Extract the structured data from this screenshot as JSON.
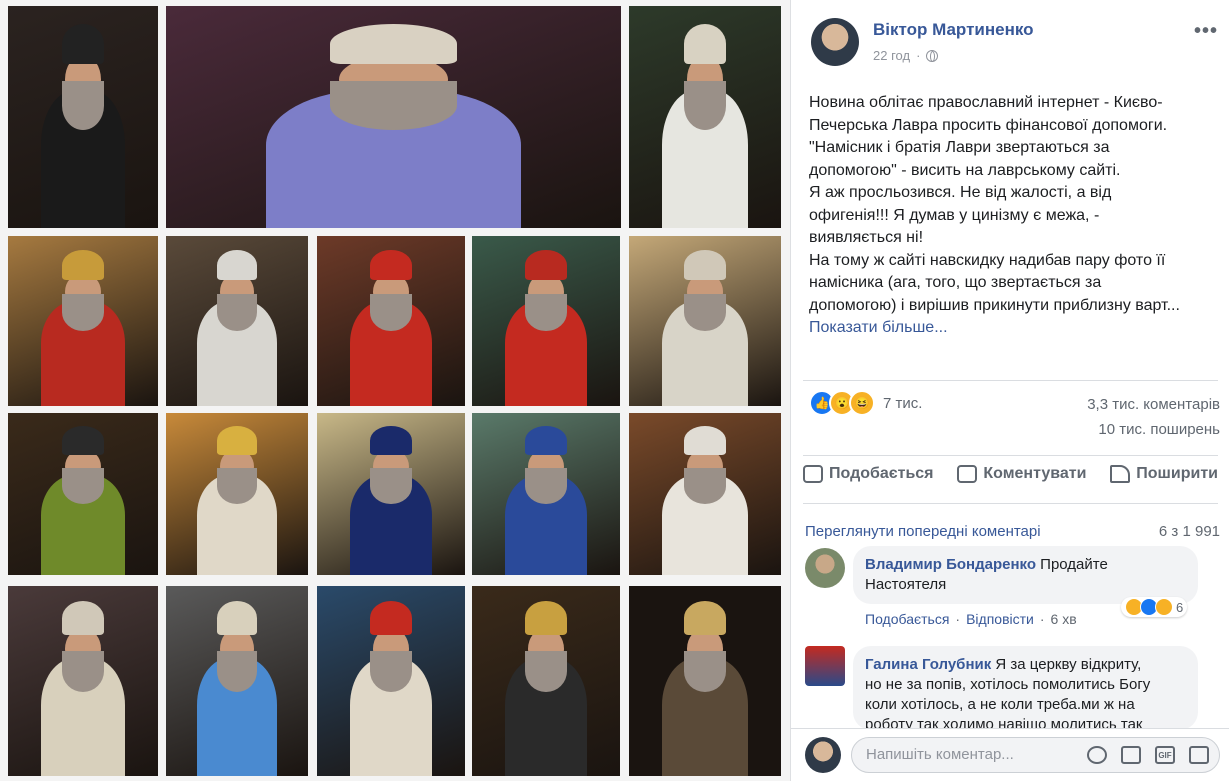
{
  "photos": [
    {
      "bg": "#2b2320",
      "robe": "#1a1a1a",
      "mitre": "#222"
    },
    {
      "bg": "#4a2a3a",
      "robe": "#7d7ec8",
      "mitre": "#d9d1c2"
    },
    {
      "bg": "#2d3a2a",
      "robe": "#e6e6e0",
      "mitre": "#d8d2c2"
    },
    {
      "bg": "#a67a40",
      "robe": "#b82a20",
      "mitre": "#c79b3a"
    },
    {
      "bg": "#5a4a3a",
      "robe": "#d8d6d0",
      "mitre": "#d8d6d0"
    },
    {
      "bg": "#6d3a28",
      "robe": "#c42a20",
      "mitre": "#c42a20"
    },
    {
      "bg": "#3a5a4a",
      "robe": "#c42a20",
      "mitre": "#b82a20"
    },
    {
      "bg": "#c4a878",
      "robe": "#d8d4c8",
      "mitre": "#d0c8b8"
    },
    {
      "bg": "#3a2a1a",
      "robe": "#6f8a2a",
      "mitre": "#2a2a2a"
    },
    {
      "bg": "#c88a3a",
      "robe": "#e0d8c8",
      "mitre": "#d8b040"
    },
    {
      "bg": "#c8b888",
      "robe": "#1a2a6a",
      "mitre": "#1a2a6a"
    },
    {
      "bg": "#5a7a6a",
      "robe": "#2a4a9a",
      "mitre": "#2a4a9a"
    },
    {
      "bg": "#7a4a2a",
      "robe": "#e8e4dc",
      "mitre": "#e0dcd4"
    },
    {
      "bg": "#4a3a3a",
      "robe": "#d8d0bc",
      "mitre": "#d0c8b8"
    },
    {
      "bg": "#5a5a5a",
      "robe": "#4a8ad0",
      "mitre": "#d8d0bc"
    },
    {
      "bg": "#2a4a6a",
      "robe": "#e0d8c8",
      "mitre": "#c42a20"
    },
    {
      "bg": "#3a2a1a",
      "robe": "#2a2a2a",
      "mitre": "#c8a040"
    },
    {
      "bg": "#1a1410",
      "robe": "#5a4a38",
      "mitre": "#c8a860"
    }
  ],
  "post": {
    "author": "Віктор Мартиненко",
    "time": "22 год",
    "more": "•••",
    "text_lines": [
      "Новина облітає православний інтернет - Києво-",
      "Печерська Лавра просить фінансової допомоги.",
      "\"Намісник і братія Лаври звертаються за",
      "допомогою\" - висить на лаврському сайті.",
      "Я аж просльозився. Не від жалості, а від",
      "офигенія!!! Я думав у цинізму є межа, -",
      "виявляється ні!",
      "На тому ж сайті навскидку надибав пару фото її",
      "намісника (ага, того, що звертається за",
      "допомогою) і вирішив прикинути приблизну варт..."
    ],
    "see_more": "Показати більше...",
    "reactions_count": "7 тис.",
    "comments_stat": "3,3 тис. коментарів",
    "shares_stat": "10 тис. поширень",
    "reaction_icons": [
      "like-icon",
      "wow-icon",
      "haha-icon"
    ]
  },
  "actions": {
    "like": "Подобається",
    "comment": "Коментувати",
    "share": "Поширити"
  },
  "comments": {
    "prev_link": "Переглянути попередні коментарі",
    "count": "6 з 1 991",
    "items": [
      {
        "name": "Владимир Бондаренко",
        "text_a": "Продайте",
        "text_b": "Настоятеля",
        "like": "Подобається",
        "reply": "Відповісти",
        "sep": "·",
        "time": "6 хв",
        "reactions": "6"
      },
      {
        "name": "Галина Голубник",
        "text_a": "Я за церкву відкриту,",
        "line2": "но не за попів, хотілось помолитись Богу",
        "line3": "коли хотілось, а не коли треба.ми ж на",
        "line4": "роботу так ходимо навіщо молитись так"
      }
    ]
  },
  "composer": {
    "placeholder": "Напишіть коментар...",
    "gif": "GIF"
  },
  "colors": {
    "link": "#385898",
    "text": "#1c1e21",
    "muted": "#606770",
    "like": "#1877f2",
    "wow": "#f7b125"
  }
}
